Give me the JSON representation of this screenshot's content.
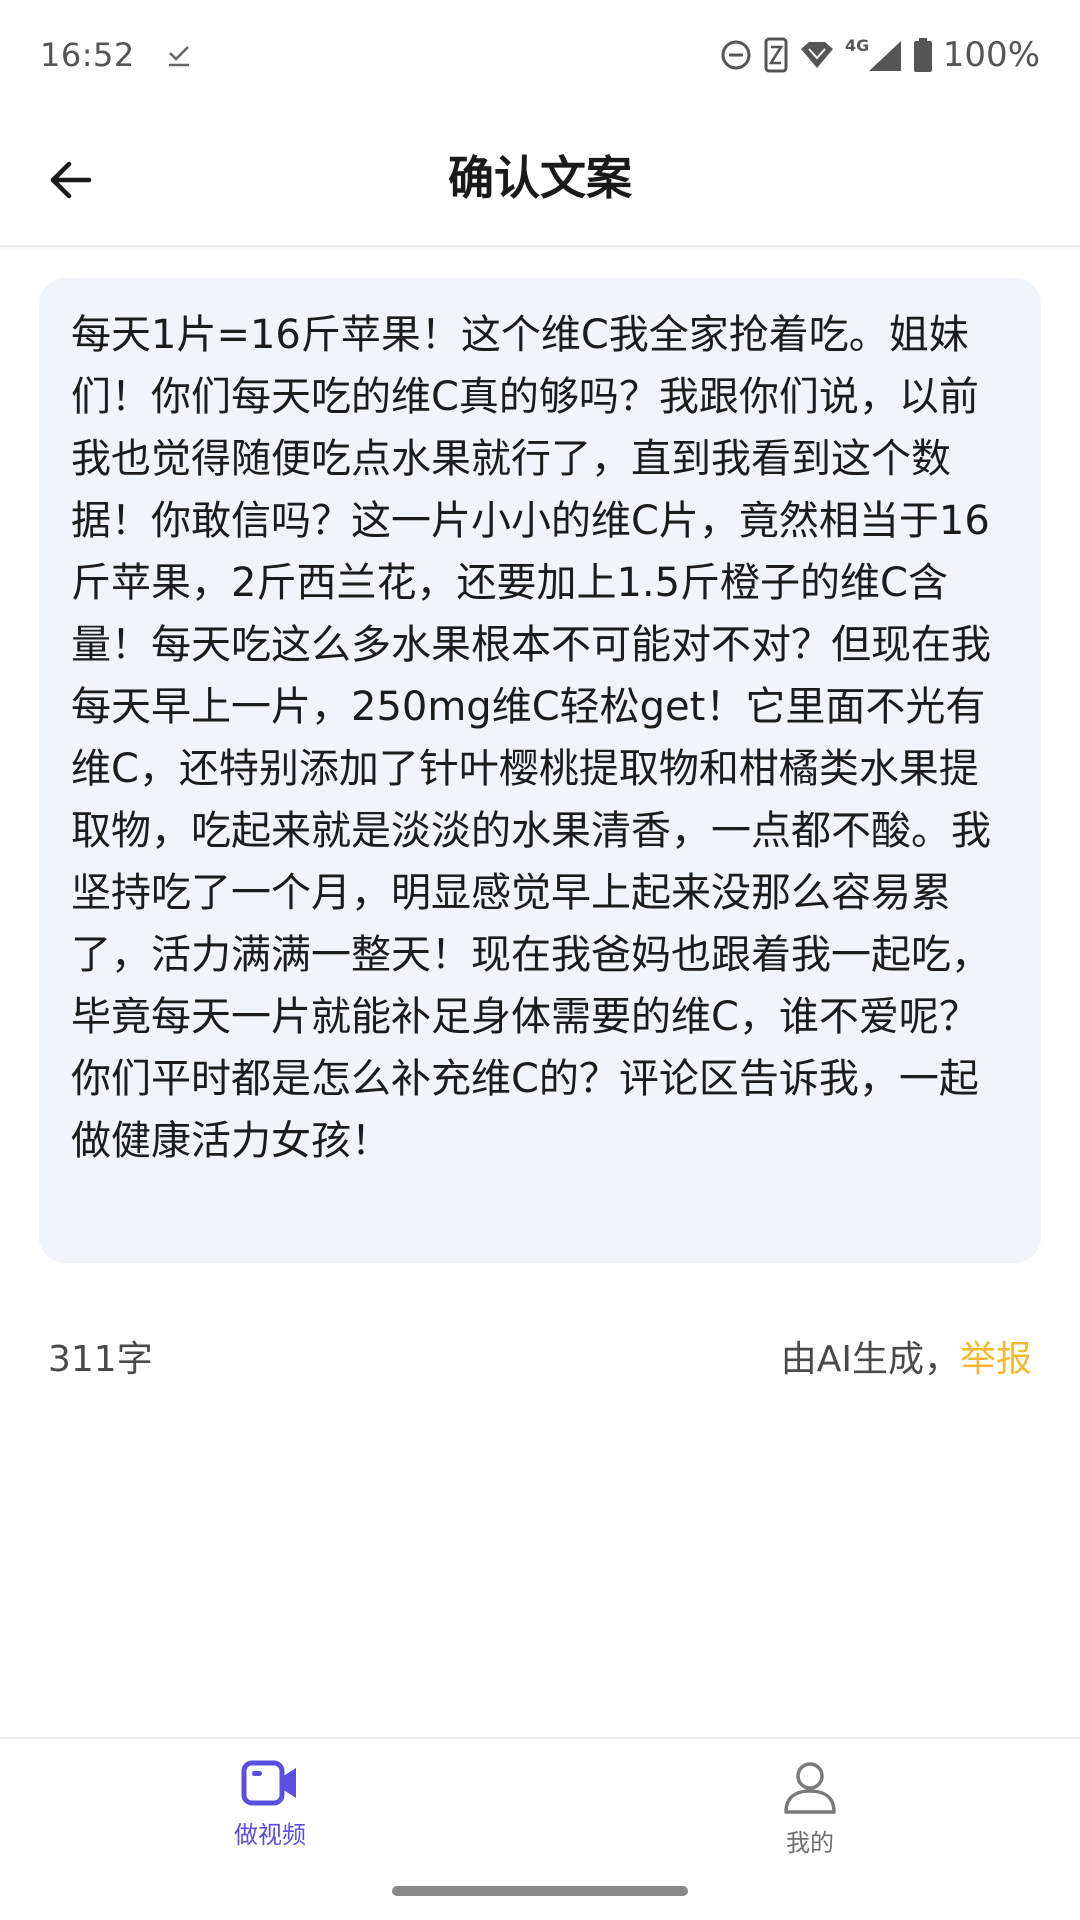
{
  "status_bar": {
    "time": "16:52",
    "battery": "100%",
    "network": "4G",
    "icons": [
      "download-done-icon",
      "do-not-disturb-icon",
      "nfc-icon",
      "wifi-icon",
      "signal-icon",
      "battery-icon"
    ]
  },
  "header": {
    "title": "确认文案",
    "back_icon": "arrow-left-icon"
  },
  "script": {
    "text": "每天1片=16斤苹果！这个维C我全家抢着吃。姐妹们！你们每天吃的维C真的够吗？我跟你们说，以前我也觉得随便吃点水果就行了，直到我看到这个数据！你敢信吗？这一片小小的维C片，竟然相当于16斤苹果，2斤西兰花，还要加上1.5斤橙子的维C含量！每天吃这么多水果根本不可能对不对？但现在我每天早上一片，250mg维C轻松get！它里面不光有维C，还特别添加了针叶樱桃提取物和柑橘类水果提取物，吃起来就是淡淡的水果清香，一点都不酸。我坚持吃了一个月，明显感觉早上起来没那么容易累了，活力满满一整天！现在我爸妈也跟着我一起吃，毕竟每天一片就能补足身体需要的维C，谁不爱呢？你们平时都是怎么补充维C的？评论区告诉我，一起做健康活力女孩！"
  },
  "meta": {
    "char_count": "311字",
    "ai_note": "由AI生成，",
    "report": "举报"
  },
  "bottom_nav": {
    "items": [
      {
        "label": "做视频",
        "icon": "video-camera-icon",
        "active": true
      },
      {
        "label": "我的",
        "icon": "person-icon",
        "active": false
      }
    ]
  },
  "colors": {
    "accent": "#5b4ee0",
    "report": "#f5b82e",
    "card_bg": "#f1f4f9"
  }
}
